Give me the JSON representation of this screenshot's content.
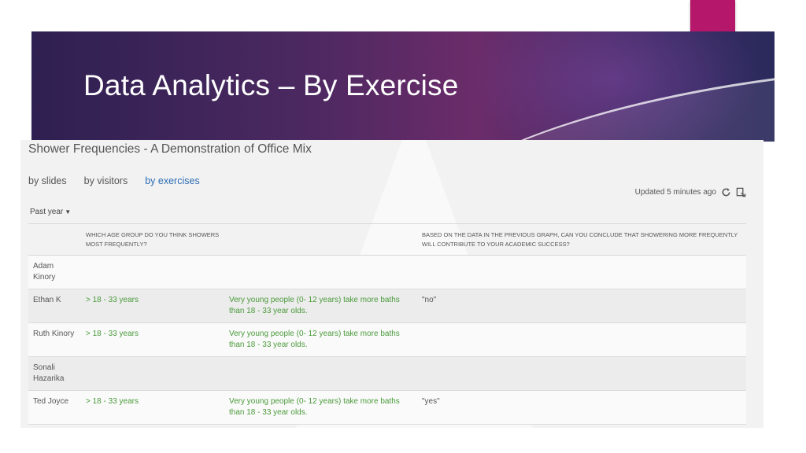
{
  "slide": {
    "title": "Data Analytics – By Exercise",
    "colors": {
      "accent": "#b5176a",
      "banner": "#4a2860"
    }
  },
  "app": {
    "title": "Shower Frequencies - A Demonstration of Office Mix",
    "nav": [
      {
        "label": "by slides",
        "active": false
      },
      {
        "label": "by visitors",
        "active": false
      },
      {
        "label": "by exercises",
        "active": true
      }
    ],
    "updated": "Updated 5 minutes ago",
    "icons": [
      "refresh-icon",
      "export-icon"
    ],
    "range": "Past year",
    "columns": {
      "q1": "Which age group do you think showers most frequently?",
      "q2": "Based on the data in the previous graph, can you conclude that showering more frequently will contribute to your academic success?"
    },
    "rows": [
      {
        "name": "Adam Kinory",
        "a1": "",
        "a1b": "",
        "a2": ""
      },
      {
        "name": "Ethan K",
        "a1": "> 18 - 33 years",
        "a1b": "Very young people (0- 12 years) take more baths than 18 - 33 year olds.",
        "a2": "\"no\""
      },
      {
        "name": "Ruth Kinory",
        "a1": "> 18 - 33 years",
        "a1b": "Very young people (0- 12 years) take more baths than 18 - 33 year olds.",
        "a2": ""
      },
      {
        "name": "Sonali Hazarika",
        "a1": "",
        "a1b": "",
        "a2": ""
      },
      {
        "name": "Ted Joyce",
        "a1": "> 18 - 33 years",
        "a1b": "Very young people (0- 12 years) take more baths than 18 - 33 year olds.",
        "a2": "\"yes\""
      }
    ]
  }
}
